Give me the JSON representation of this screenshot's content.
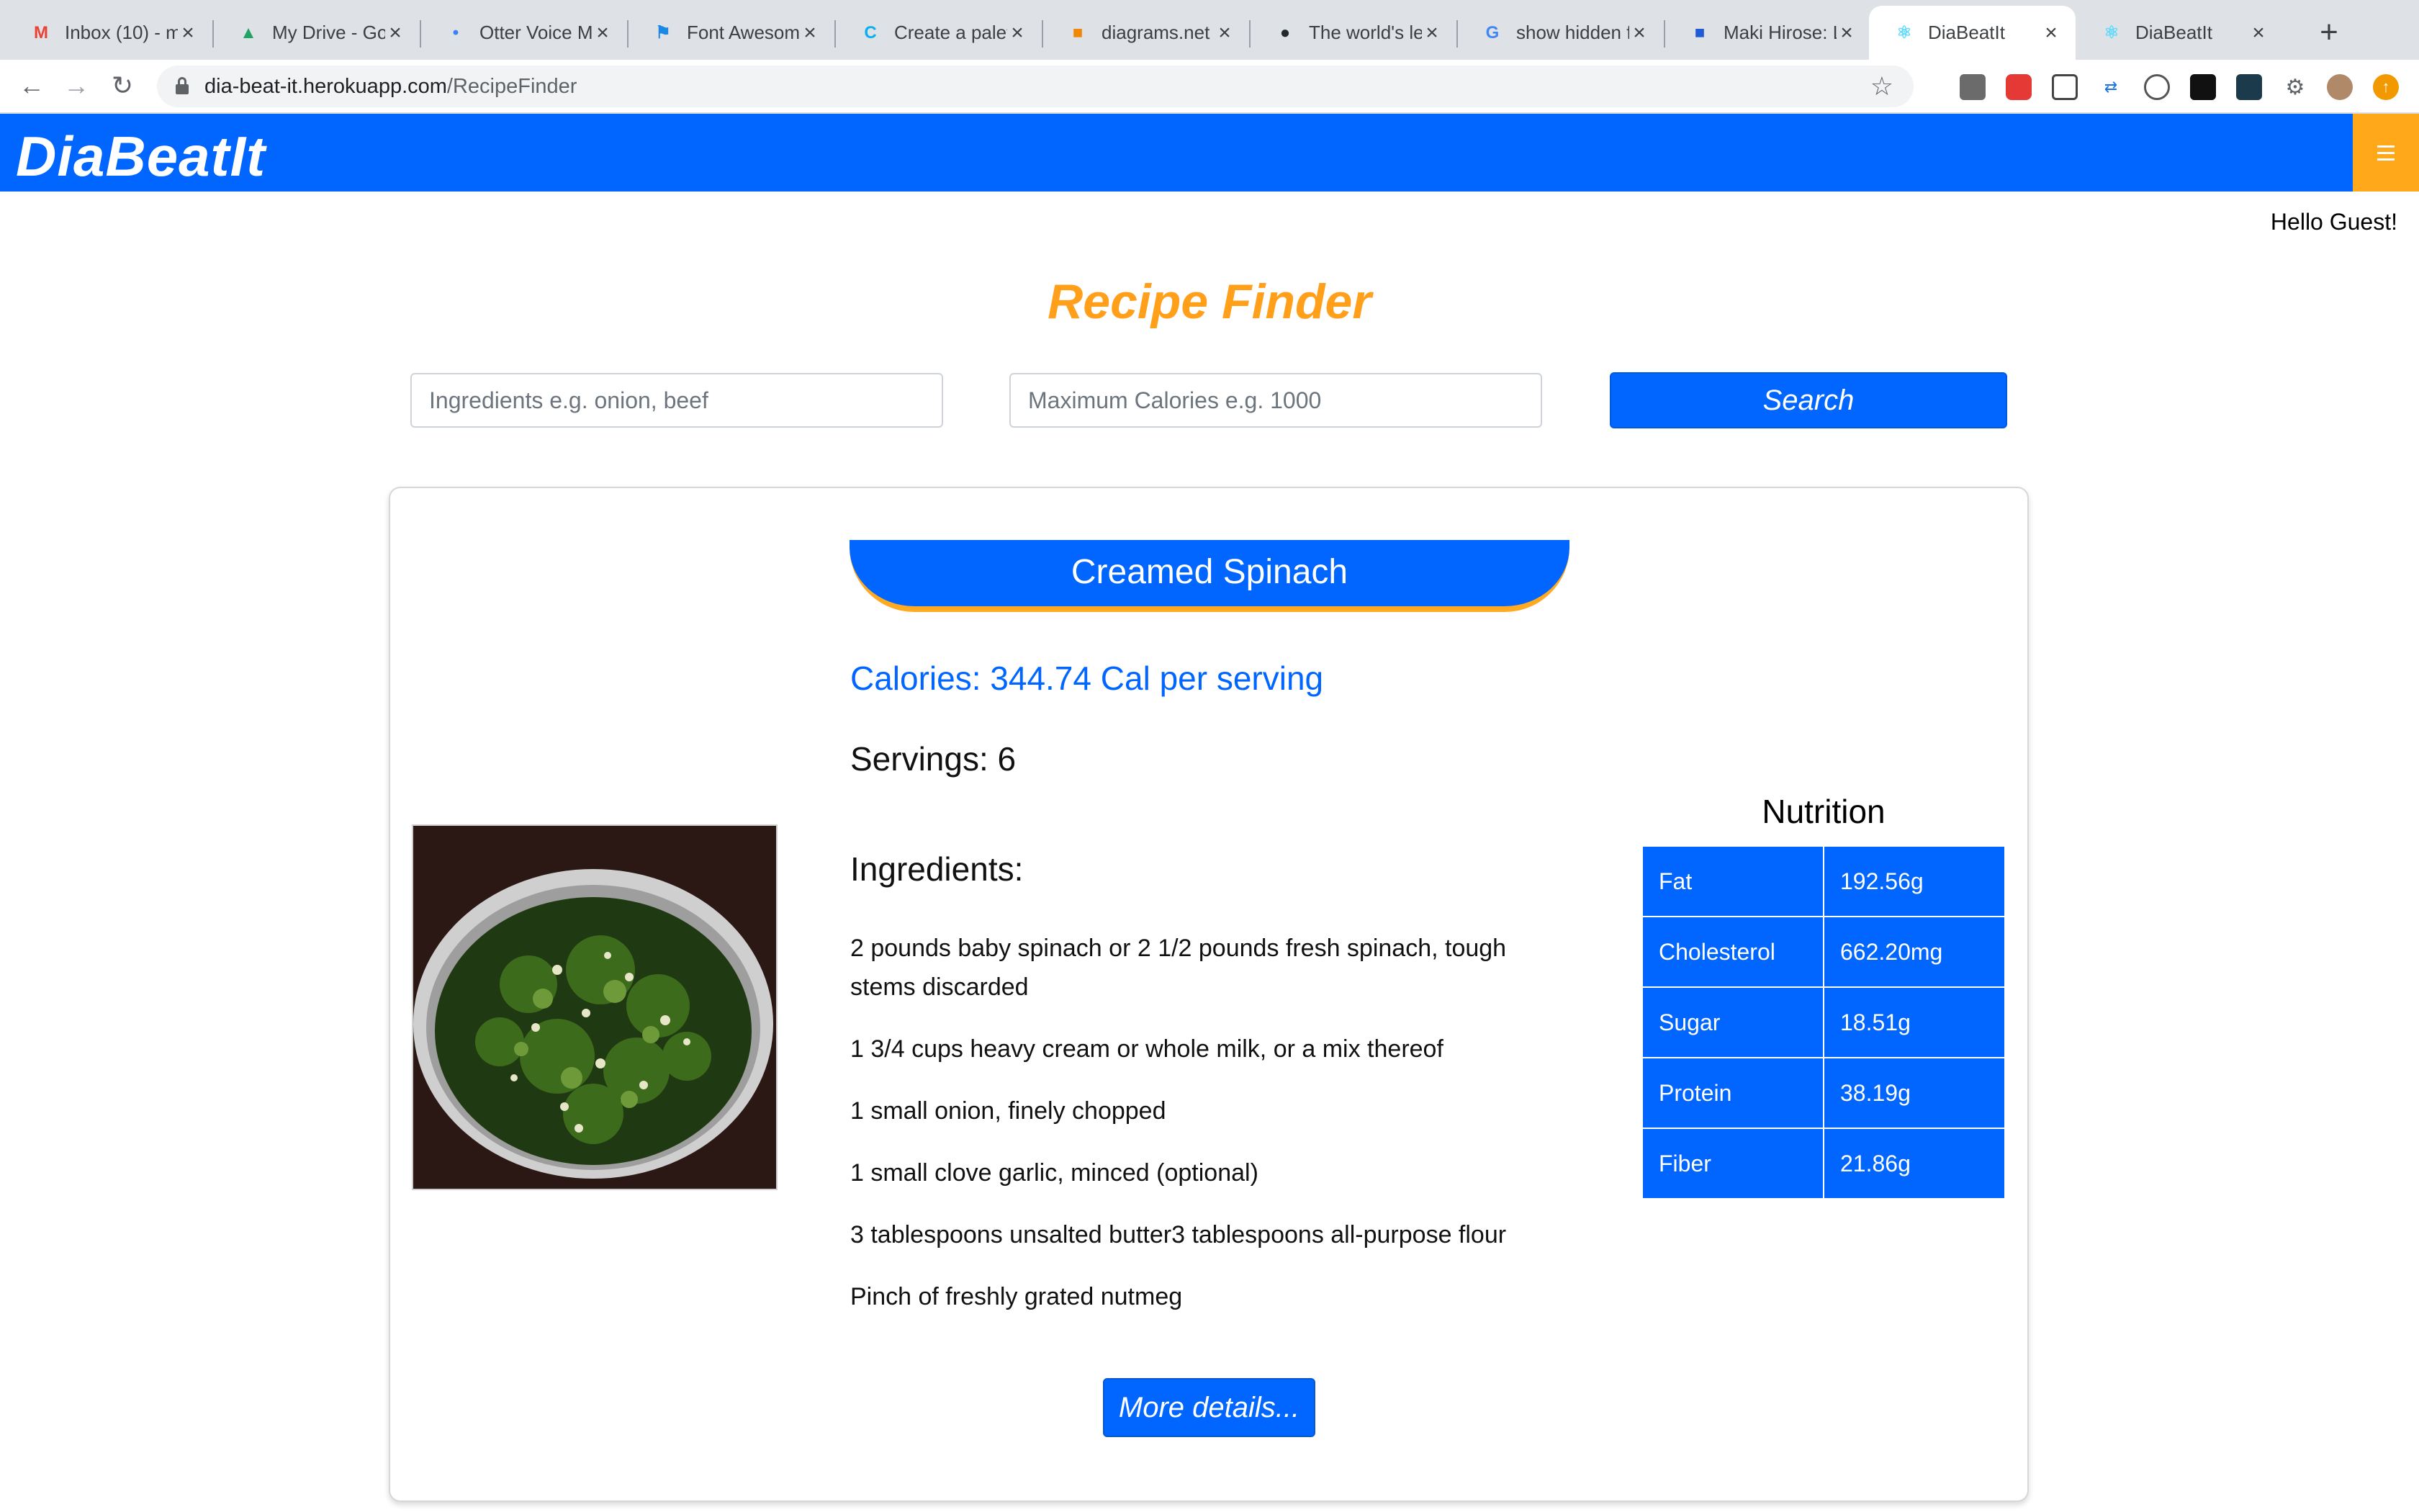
{
  "browser": {
    "tabs": [
      {
        "title": "Inbox (10) - m",
        "icon": "gmail-icon",
        "color": "#ea4335"
      },
      {
        "title": "My Drive - Go",
        "icon": "google-drive-icon",
        "color": "#1fa463"
      },
      {
        "title": "Otter Voice M",
        "icon": "otter-icon",
        "color": "#3b82f6"
      },
      {
        "title": "Font Awesom",
        "icon": "font-awesome-flag-icon",
        "color": "#1c88e5"
      },
      {
        "title": "Create a palet",
        "icon": "coolors-icon",
        "color": "#0aaff1"
      },
      {
        "title": "diagrams.net",
        "icon": "diagrams-icon",
        "color": "#f08705"
      },
      {
        "title": "The world's le",
        "icon": "github-icon",
        "color": "#24292e"
      },
      {
        "title": "show hidden f",
        "icon": "google-icon",
        "color": "#4285f4"
      },
      {
        "title": "Maki Hirose: L",
        "icon": "square-logo-icon",
        "color": "#1e5bd6"
      },
      {
        "title": "DiaBeatIt",
        "icon": "react-icon",
        "color": "#61dafb",
        "active": true
      },
      {
        "title": "DiaBeatIt",
        "icon": "react-icon",
        "color": "#61dafb"
      }
    ],
    "new_tab_label": "+",
    "url_host": "dia-beat-it.herokuapp.com",
    "url_path": "/RecipeFinder"
  },
  "app": {
    "brand": "DiaBeatIt",
    "greeting": "Hello Guest!",
    "page_title": "Recipe Finder",
    "accent_color": "#0066ff",
    "brand_orange": "#ffa81a"
  },
  "search": {
    "ingredients_placeholder": "Ingredients e.g. onion, beef",
    "ingredients_value": "",
    "calories_placeholder": "Maximum Calories e.g. 1000",
    "calories_value": "",
    "button_label": "Search"
  },
  "recipe": {
    "title": "Creamed Spinach",
    "calories": "Calories: 344.74 Cal per serving",
    "servings": "Servings: 6",
    "ingredients_heading": "Ingredients:",
    "ingredients": [
      "2 pounds baby spinach or 2 1/2 pounds fresh spinach, tough stems discarded",
      "1 3/4 cups heavy cream or whole milk, or a mix thereof",
      "1 small onion, finely chopped",
      "1 small clove garlic, minced (optional)",
      "3 tablespoons unsalted butter3 tablespoons all-purpose flour",
      "Pinch of freshly grated nutmeg"
    ],
    "more_button": "More details..."
  },
  "nutrition": {
    "heading": "Nutrition",
    "rows": [
      {
        "label": "Fat",
        "value": "192.56g"
      },
      {
        "label": "Cholesterol",
        "value": "662.20mg"
      },
      {
        "label": "Sugar",
        "value": "18.51g"
      },
      {
        "label": "Protein",
        "value": "38.19g"
      },
      {
        "label": "Fiber",
        "value": "21.86g"
      }
    ]
  }
}
